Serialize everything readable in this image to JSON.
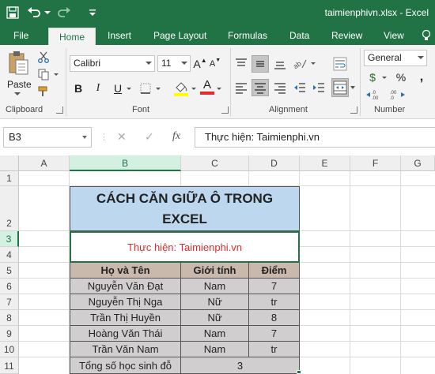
{
  "app": {
    "title": "taimienphivn.xlsx - Excel"
  },
  "ribbon": {
    "tabs": [
      {
        "label": "File",
        "active": false
      },
      {
        "label": "Home",
        "active": true
      },
      {
        "label": "Insert",
        "active": false
      },
      {
        "label": "Page Layout",
        "active": false
      },
      {
        "label": "Formulas",
        "active": false
      },
      {
        "label": "Data",
        "active": false
      },
      {
        "label": "Review",
        "active": false
      },
      {
        "label": "View",
        "active": false
      }
    ],
    "clipboard": {
      "label": "Clipboard",
      "paste_label": "Paste"
    },
    "font": {
      "label": "Font",
      "family": "Calibri",
      "size": "11",
      "bold": "B",
      "italic": "I",
      "underline": "U",
      "grow": "A",
      "shrink": "A",
      "font_color_glyph": "A"
    },
    "alignment": {
      "label": "Alignment"
    },
    "number": {
      "label": "Number",
      "format": "General",
      "currency": "$",
      "percent": "%"
    }
  },
  "formula_bar": {
    "name_box": "B3",
    "fx_label": "fx",
    "cancel": "✕",
    "enter": "✓",
    "content": "Thực hiện: Taimienphi.vn"
  },
  "sheet": {
    "columns": [
      "A",
      "B",
      "C",
      "D",
      "E",
      "F",
      "G"
    ],
    "selected_column": "B",
    "rows": [
      "1",
      "2",
      "3",
      "4",
      "5",
      "6",
      "7",
      "8",
      "9",
      "10",
      "11"
    ],
    "selected_row": "3",
    "title_line1": "CÁCH CĂN GIỮA Ô TRONG",
    "title_line2": "EXCEL",
    "subtitle": "Thực hiện: Taimienphi.vn",
    "table_headers": [
      "Họ và Tên",
      "Giới tính",
      "Điểm"
    ],
    "table_rows": [
      [
        "Nguyễn Văn Đạt",
        "Nam",
        "7"
      ],
      [
        "Nguyễn Thị Nga",
        "Nữ",
        "tr"
      ],
      [
        "Trần Thị Huyền",
        "Nữ",
        "8"
      ],
      [
        "Hoàng Văn Thái",
        "Nam",
        "7"
      ],
      [
        "Trần Văn Nam",
        "Nam",
        "tr"
      ]
    ],
    "summary_label": "Tổng số học sinh đỗ",
    "summary_value": "3"
  },
  "colors": {
    "excel_green": "#217346",
    "title_fill": "#bdd7ee",
    "header_fill": "#c9b8ac",
    "body_fill": "#d0cece",
    "subtitle_color": "#e32b2b"
  }
}
